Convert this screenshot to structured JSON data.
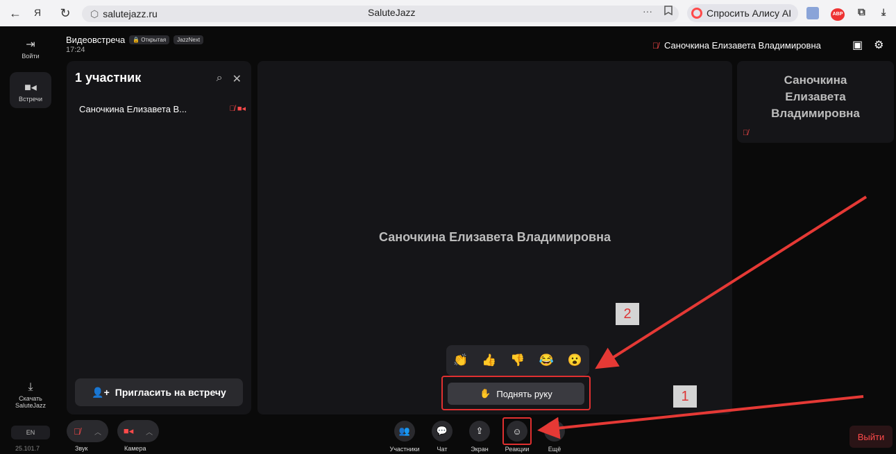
{
  "browser": {
    "back": "←",
    "ya": "Я",
    "reload": "↻",
    "url": "salutejazz.ru",
    "page_title": "SaluteJazz",
    "dots": "···",
    "bookmark": "⍞",
    "alice_label": "Спросить Алису AI",
    "ext_abp": "ABP"
  },
  "rail": {
    "login_label": "Войти",
    "meetings_label": "Встречи",
    "download_label": "Скачать SaluteJazz",
    "lang": "EN",
    "version": "25.101.7"
  },
  "header": {
    "title": "Видеовстреча",
    "badge_open": "Открытая",
    "badge_next": "JazzNext",
    "time": "17:24",
    "speaker_name": "Саночкина Елизавета Владимировна"
  },
  "participants": {
    "title": "1 участник",
    "items": [
      {
        "name": "Саночкина Елизавета В..."
      }
    ],
    "invite_label": "Пригласить на встречу"
  },
  "stage": {
    "name": "Саночкина Елизавета Владимировна"
  },
  "tile": {
    "name": "Саночкина\nЕлизавета\nВладимировна"
  },
  "reactions": {
    "emojis": [
      "👏",
      "👍",
      "👎",
      "😂",
      "😮"
    ],
    "raise_hand_label": "Поднять руку"
  },
  "callouts": {
    "one": "1",
    "two": "2"
  },
  "toolbar": {
    "sound_label": "Звук",
    "camera_label": "Камера",
    "participants_label": "Участники",
    "chat_label": "Чат",
    "screen_label": "Экран",
    "reactions_label": "Реакции",
    "more_label": "Ещё",
    "leave_label": "Выйти"
  },
  "colors": {
    "accent_red": "#e03030",
    "bg": "#0a0a0a",
    "panel": "#151518"
  }
}
